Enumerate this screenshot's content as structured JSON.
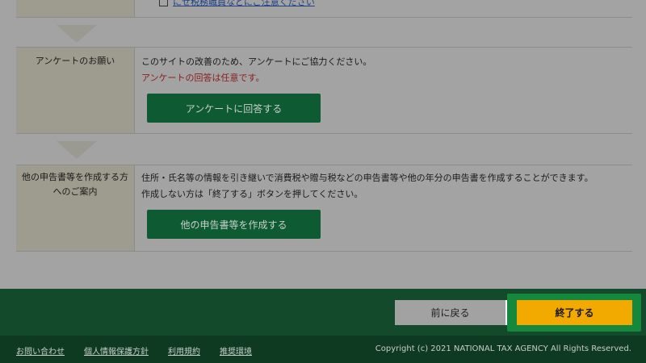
{
  "top_row": {
    "link_icon": "external-link-icon",
    "link_text": "にせ税務職員などにご注意ください"
  },
  "survey_row": {
    "label": "アンケートのお願い",
    "text": "このサイトの改善のため、アンケートにご協力ください。",
    "note": "アンケートの回答は任意です。",
    "button_label": "アンケートに回答する"
  },
  "other_row": {
    "label": "他の申告書等を作成する方へのご案内",
    "text1": "住所・氏名等の情報を引き継いで消費税や贈与税などの申告書等や他の年分の申告書を作成することができます。",
    "text2": "作成しない方は「終了する」ボタンを押してください。",
    "button_label": "他の申告書等を作成する"
  },
  "nav": {
    "back_label": "前に戻る",
    "finish_label": "終了する"
  },
  "footer": {
    "links": [
      "お問い合わせ",
      "個人情報保護方針",
      "利用規約",
      "推奨環境"
    ],
    "copyright": "Copyright (c) 2021 NATIONAL TAX AGENCY All Rights Reserved."
  },
  "colors": {
    "accent_green": "#0e5a33",
    "finish_yellow": "#f2a900",
    "note_red": "#8a1d1d"
  }
}
